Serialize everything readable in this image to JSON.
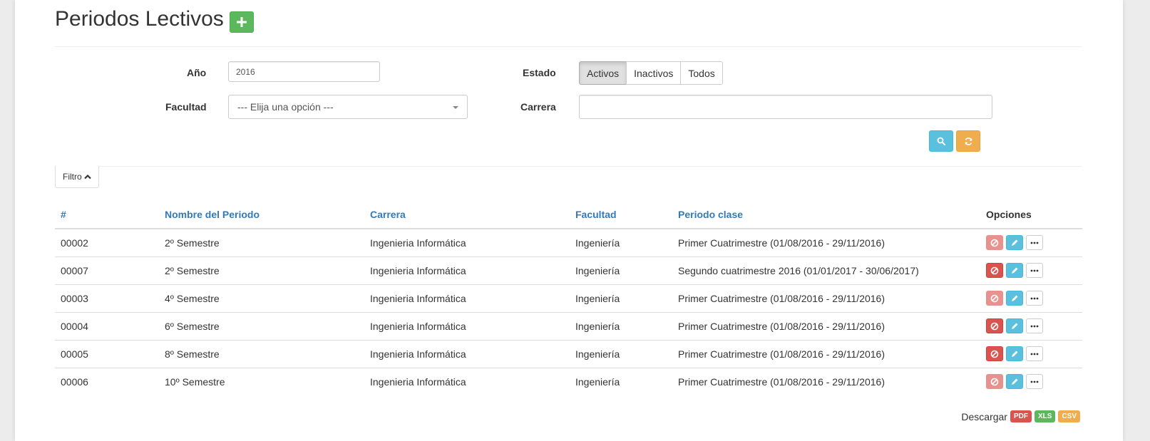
{
  "page": {
    "title": "Periodos Lectivos"
  },
  "filters": {
    "year_label": "Año",
    "year_value": "2016",
    "faculty_label": "Facultad",
    "faculty_value": "--- Elija una opción ---",
    "state_label": "Estado",
    "state_options": [
      "Activos",
      "Inactivos",
      "Todos"
    ],
    "state_selected": "Activos",
    "career_label": "Carrera",
    "career_value": "",
    "toggle_label": "Filtro"
  },
  "table": {
    "headers": [
      "#",
      "Nombre del Periodo",
      "Carrera",
      "Facultad",
      "Periodo clase",
      "Opciones"
    ],
    "rows": [
      {
        "id": "00002",
        "name": "2º Semestre",
        "career": "Ingenieria Informática",
        "faculty": "Ingeniería",
        "period": "Primer Cuatrimestre (01/08/2016 - 29/11/2016)",
        "delete_enabled": false
      },
      {
        "id": "00007",
        "name": "2º Semestre",
        "career": "Ingenieria Informática",
        "faculty": "Ingeniería",
        "period": "Segundo cuatrimestre 2016 (01/01/2017 - 30/06/2017)",
        "delete_enabled": true
      },
      {
        "id": "00003",
        "name": "4º Semestre",
        "career": "Ingenieria Informática",
        "faculty": "Ingeniería",
        "period": "Primer Cuatrimestre (01/08/2016 - 29/11/2016)",
        "delete_enabled": false
      },
      {
        "id": "00004",
        "name": "6º Semestre",
        "career": "Ingenieria Informática",
        "faculty": "Ingeniería",
        "period": "Primer Cuatrimestre (01/08/2016 - 29/11/2016)",
        "delete_enabled": true
      },
      {
        "id": "00005",
        "name": "8º Semestre",
        "career": "Ingenieria Informática",
        "faculty": "Ingeniería",
        "period": "Primer Cuatrimestre (01/08/2016 - 29/11/2016)",
        "delete_enabled": true
      },
      {
        "id": "00006",
        "name": "10º Semestre",
        "career": "Ingenieria Informática",
        "faculty": "Ingeniería",
        "period": "Primer Cuatrimestre (01/08/2016 - 29/11/2016)",
        "delete_enabled": false
      }
    ]
  },
  "download": {
    "label": "Descargar",
    "formats": [
      {
        "label": "PDF",
        "color": "#d9534f"
      },
      {
        "label": "XLS",
        "color": "#5cb85c"
      },
      {
        "label": "CSV",
        "color": "#f0ad4e"
      }
    ]
  },
  "icons": {
    "add": "plus-icon",
    "search": "search-icon",
    "reset": "refresh-icon",
    "filter_toggle": "chevron-up-icon",
    "row_delete": "ban-icon",
    "row_edit": "pencil-icon",
    "row_more": "ellipsis-icon"
  },
  "colors": {
    "link": "#337ab7",
    "success": "#5cb85c",
    "info": "#5bc0de",
    "warning": "#f0ad4e",
    "danger": "#d9534f"
  }
}
